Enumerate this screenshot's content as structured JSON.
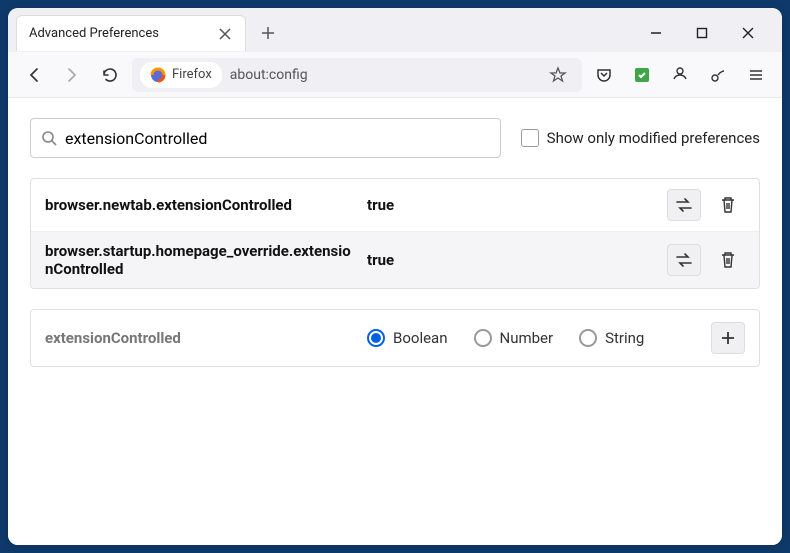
{
  "window": {
    "tab_title": "Advanced Preferences"
  },
  "urlbar": {
    "identity_label": "Firefox",
    "url": "about:config"
  },
  "search": {
    "value": "extensionControlled",
    "show_modified_label": "Show only modified preferences"
  },
  "prefs": [
    {
      "name": "browser.newtab.extensionControlled",
      "value": "true"
    },
    {
      "name": "browser.startup.homepage_override.extensionControlled",
      "value": "true"
    }
  ],
  "add": {
    "name": "extensionControlled",
    "types": {
      "boolean": "Boolean",
      "number": "Number",
      "string": "String"
    }
  }
}
